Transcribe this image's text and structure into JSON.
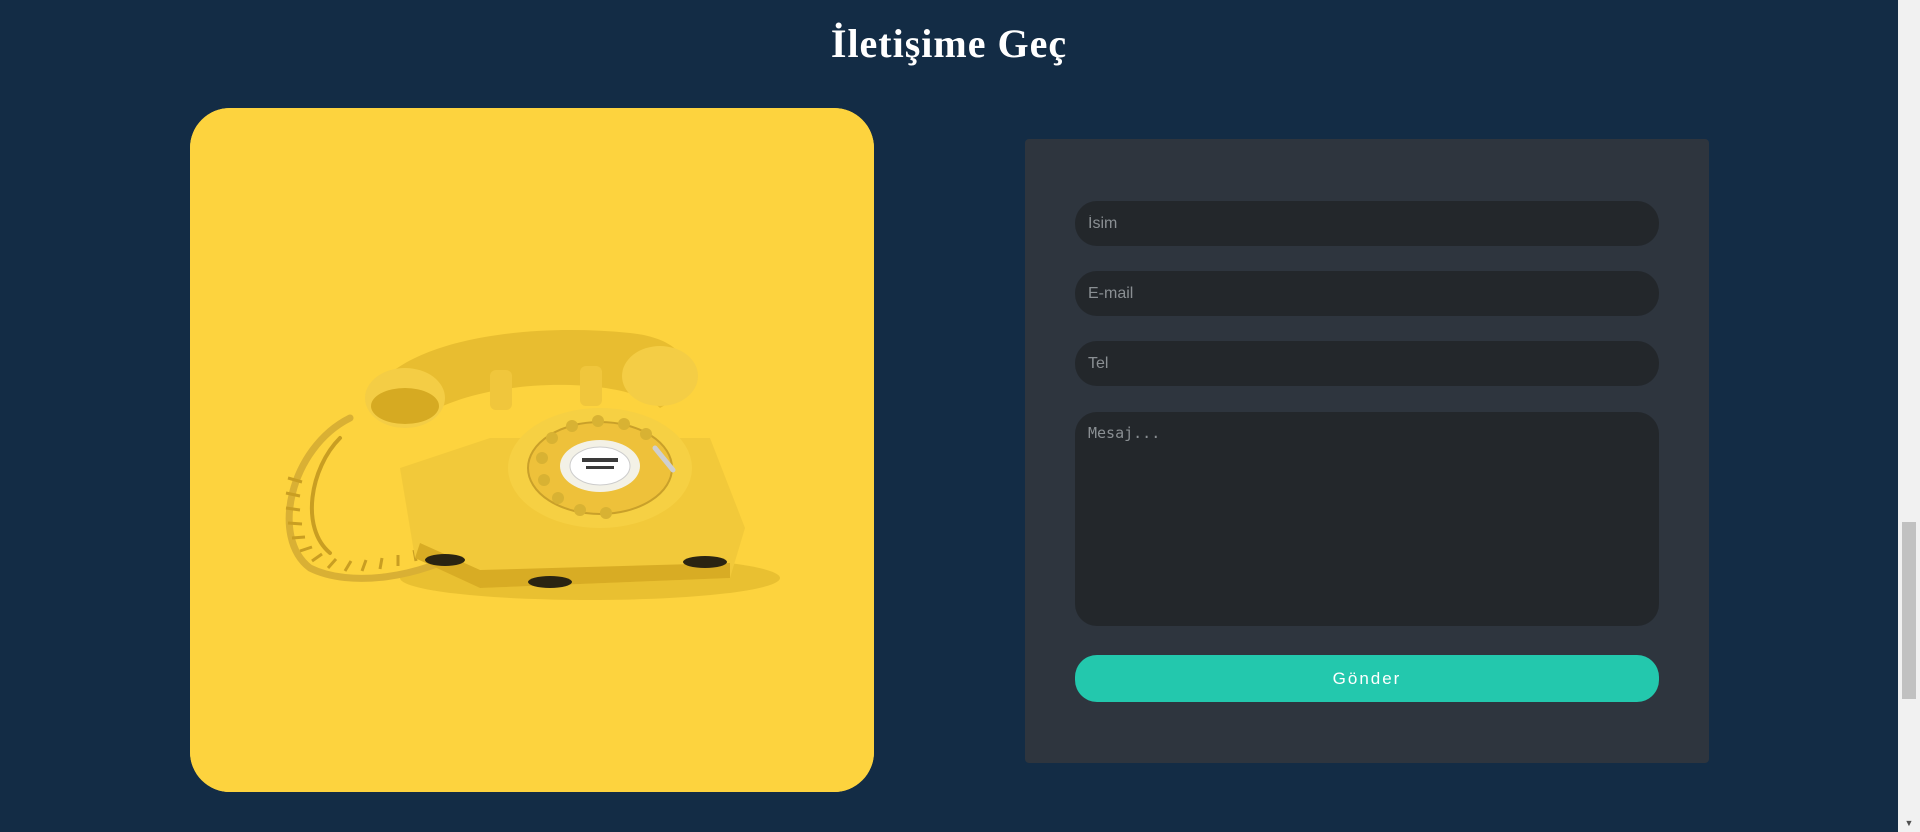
{
  "page": {
    "title": "İletişime Geç"
  },
  "image": {
    "subject": "yellow-rotary-telephone",
    "background_color": "#fdd33e"
  },
  "form": {
    "name_placeholder": "İsim",
    "email_placeholder": "E-mail",
    "phone_placeholder": "Tel",
    "message_placeholder": "Mesaj...",
    "submit_label": "Gönder"
  },
  "colors": {
    "page_background": "#132c45",
    "panel_background": "#2e353e",
    "field_background": "#23272b",
    "accent": "#23c8ad"
  },
  "scrollbar": {
    "down_arrow": "▼"
  }
}
